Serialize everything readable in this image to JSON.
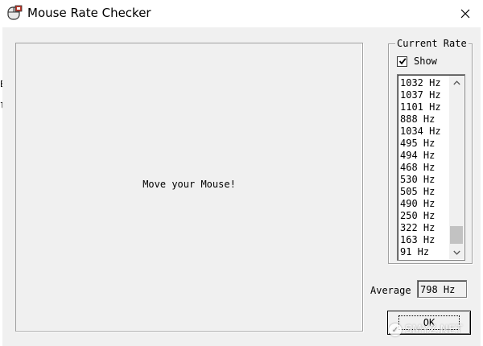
{
  "window": {
    "title": "Mouse Rate Checker"
  },
  "background_window": {
    "fragments": [
      "E",
      "le"
    ]
  },
  "main_panel": {
    "message": "Move your Mouse!"
  },
  "current_rate": {
    "group_label": "Current Rate",
    "show_label": "Show",
    "show_checked": true,
    "rates": [
      "1032 Hz",
      "1037 Hz",
      "1101 Hz",
      "888 Hz",
      "1034 Hz",
      "495 Hz",
      "494 Hz",
      "468 Hz",
      "530 Hz",
      "505 Hz",
      "490 Hz",
      "250 Hz",
      "322 Hz",
      "163 Hz",
      "91 Hz"
    ],
    "scroll_position": 1.0
  },
  "average": {
    "label": "Average",
    "value": "798 Hz"
  },
  "buttons": {
    "ok_label": "OK"
  },
  "watermark": {
    "text": "SMYZ.NET"
  }
}
